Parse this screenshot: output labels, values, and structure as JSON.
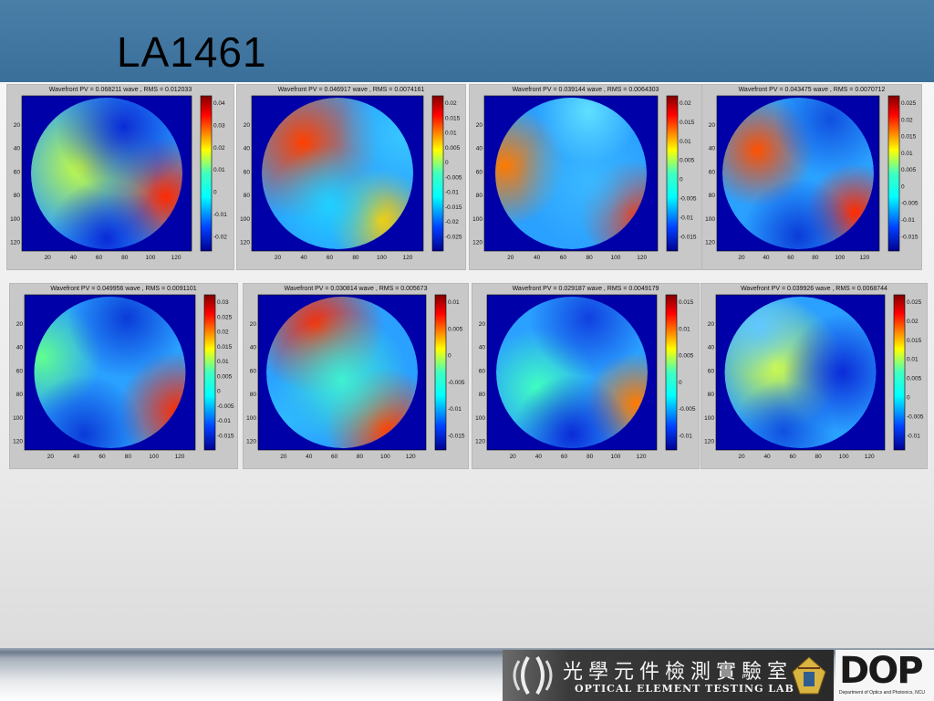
{
  "slide": {
    "title": "LA1461"
  },
  "colors": {
    "header_band": "#3f76a0",
    "panel_bg": "#c8c8c8",
    "colormap": "jet"
  },
  "axes": {
    "y_ticks": [
      "20",
      "40",
      "60",
      "80",
      "100",
      "120"
    ],
    "x_ticks": [
      "20",
      "40",
      "60",
      "80",
      "100",
      "120"
    ]
  },
  "panels": [
    {
      "title": "Wavefront PV = 0.068211 wave , RMS = 0.012033",
      "cbar": [
        "0.04",
        "0.03",
        "0.02",
        "0.01",
        "0",
        "-0.01",
        "-0.02"
      ]
    },
    {
      "title": "Wavefront PV = 0.046917 wave , RMS = 0.0074161",
      "cbar": [
        "0.02",
        "0.015",
        "0.01",
        "0.005",
        "0",
        "-0.005",
        "-0.01",
        "-0.015",
        "-0.02",
        "-0.025"
      ]
    },
    {
      "title": "Wavefront PV = 0.039144 wave , RMS = 0.0064303",
      "cbar": [
        "0.02",
        "0.015",
        "0.01",
        "0.005",
        "0",
        "-0.005",
        "-0.01",
        "-0.015"
      ]
    },
    {
      "title": "Wavefront PV = 0.043475 wave , RMS = 0.0070712",
      "cbar": [
        "0.025",
        "0.02",
        "0.015",
        "0.01",
        "0.005",
        "0",
        "-0.005",
        "-0.01",
        "-0.015"
      ]
    },
    {
      "title": "Wavefront PV = 0.049956 wave , RMS = 0.0091101",
      "cbar": [
        "0.03",
        "0.025",
        "0.02",
        "0.015",
        "0.01",
        "0.005",
        "0",
        "-0.005",
        "-0.01",
        "-0.015"
      ]
    },
    {
      "title": "Wavefront PV = 0.030814 wave , RMS = 0.005673",
      "cbar": [
        "0.01",
        "0.005",
        "0",
        "-0.005",
        "-0.01",
        "-0.015"
      ]
    },
    {
      "title": "Wavefront PV = 0.029187 wave , RMS = 0.0049179",
      "cbar": [
        "0.015",
        "0.01",
        "0.005",
        "0",
        "-0.005",
        "-0.01"
      ]
    },
    {
      "title": "Wavefront PV = 0.039926 wave , RMS = 0.0068744",
      "cbar": [
        "0.025",
        "0.02",
        "0.015",
        "0.01",
        "0.005",
        "0",
        "-0.005",
        "-0.01"
      ]
    }
  ],
  "footer": {
    "lab_name_cn": "光學元件檢測實驗室",
    "lab_name_en": "OPTICAL ELEMENT TESTING LAB",
    "logo_text": "DOP",
    "dept_text": "Department of Optics and Photonics, NCU"
  }
}
